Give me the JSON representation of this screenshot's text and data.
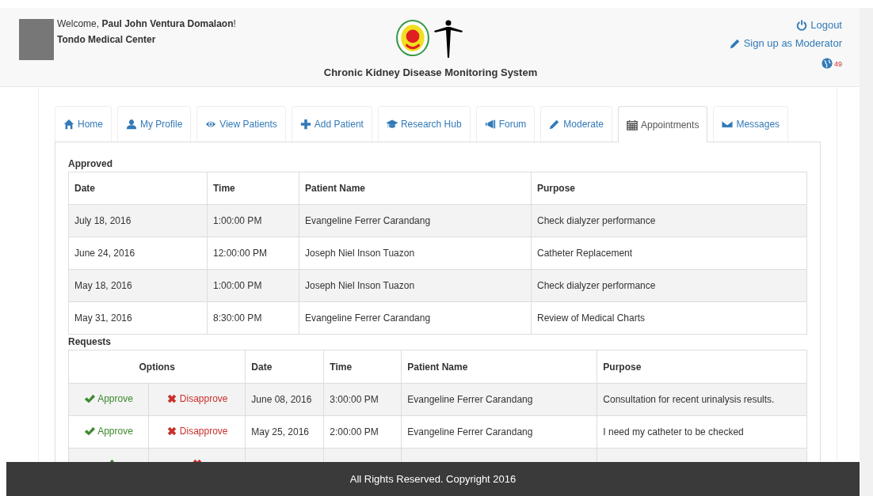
{
  "header": {
    "welcome_prefix": "Welcome, ",
    "user_name": "Paul John Ventura Domalaon",
    "welcome_suffix": "!",
    "hospital": "Tondo Medical Center",
    "system_title": "Chronic Kidney Disease Monitoring System",
    "logout": "Logout",
    "moderator_signup": "Sign up as Moderator",
    "notification_count": "49"
  },
  "tabs": [
    {
      "label": "Home",
      "selected": false
    },
    {
      "label": "My Profile",
      "selected": false
    },
    {
      "label": "View Patients",
      "selected": false
    },
    {
      "label": "Add Patient",
      "selected": false
    },
    {
      "label": "Research Hub",
      "selected": false
    },
    {
      "label": "Forum",
      "selected": false
    },
    {
      "label": "Moderate",
      "selected": false
    },
    {
      "label": "Appointments",
      "selected": true
    },
    {
      "label": "Messages",
      "selected": false
    }
  ],
  "approved": {
    "title": "Approved",
    "columns": [
      "Date",
      "Time",
      "Patient Name",
      "Purpose"
    ],
    "rows": [
      [
        "July 18, 2016",
        "1:00:00 PM",
        "Evangeline Ferrer Carandang",
        "Check dialyzer performance"
      ],
      [
        "June 24, 2016",
        "12:00:00 PM",
        "Joseph Niel Inson Tuazon",
        "Catheter Replacement"
      ],
      [
        "May 18, 2016",
        "1:00:00 PM",
        "Joseph Niel Inson Tuazon",
        "Check dialyzer performance"
      ],
      [
        "May 31, 2016",
        "8:30:00 PM",
        "Evangeline Ferrer Carandang",
        "Review of Medical Charts"
      ]
    ]
  },
  "requests": {
    "title": "Requests",
    "options_header": "Options",
    "columns": [
      "Date",
      "Time",
      "Patient Name",
      "Purpose"
    ],
    "rows": [
      {
        "approve": "Approve",
        "disapprove": "Disapprove",
        "cells": [
          "June 08, 2016",
          "3:00:00 PM",
          "Evangeline Ferrer Carandang",
          "Consultation for recent urinalysis results."
        ]
      },
      {
        "approve": "Approve",
        "disapprove": "Disapprove",
        "cells": [
          "May 25, 2016",
          "2:00:00 PM",
          "Evangeline Ferrer Carandang",
          "I need my catheter to be checked"
        ]
      }
    ]
  },
  "footer": "All Rights Reserved. Copyright 2016"
}
